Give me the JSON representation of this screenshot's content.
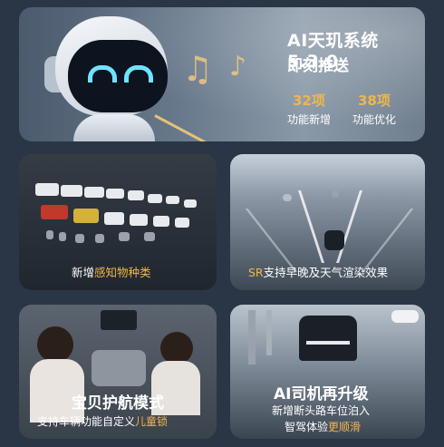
{
  "hero": {
    "title": "AI天玑系统5.3.0",
    "subtitle": "即刻推送",
    "stats": [
      {
        "value": "32项",
        "label": "功能新增"
      },
      {
        "value": "38项",
        "label": "功能优化"
      }
    ]
  },
  "cards": [
    {
      "caption_pre": "新增",
      "caption_hl": "感知物种类",
      "caption_post": ""
    },
    {
      "caption_pre": "",
      "caption_hl": "SR",
      "caption_post": "支持早晚及天气渲染效果"
    },
    {
      "title": "宝贝护航模式",
      "sub_pre": "支持车辆功能自定义",
      "sub_hl": "儿童锁"
    },
    {
      "title": "AI司机再升级",
      "line1": "新增断头路车位泊入",
      "line2_pre": "智驾体验",
      "line2_hl": "更顺滑"
    }
  ],
  "colors": {
    "accent": "#f0b64b",
    "background": "#2a3646"
  }
}
